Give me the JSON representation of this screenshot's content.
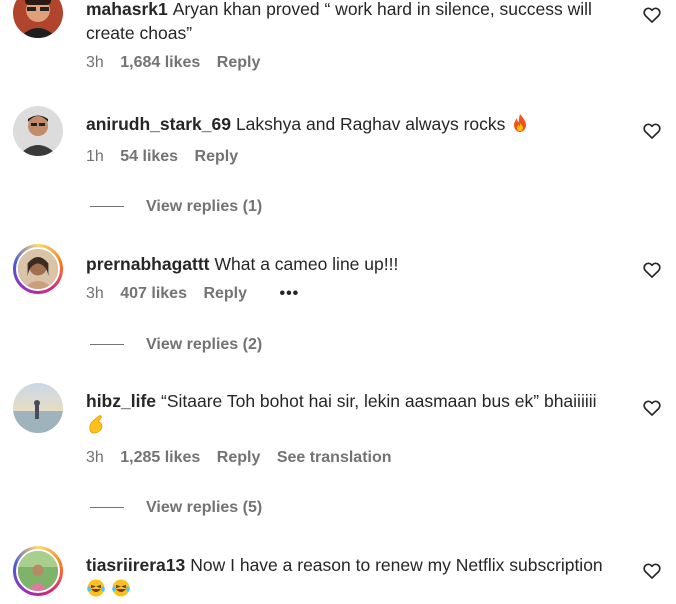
{
  "comments": [
    {
      "username": "mahasrk1",
      "text": "Aryan khan proved “ work hard in silence, success will create choas”",
      "time": "3h",
      "likes": "1,684 likes",
      "reply": "Reply"
    },
    {
      "username": "anirudh_stark_69",
      "text": "Lakshya and Raghav always rocks",
      "time": "1h",
      "likes": "54 likes",
      "reply": "Reply",
      "view_replies": "View replies (1)"
    },
    {
      "username": "prernabhagattt",
      "text": "What a cameo line up!!!",
      "time": "3h",
      "likes": "407 likes",
      "reply": "Reply",
      "more": "•••",
      "view_replies": "View replies (2)"
    },
    {
      "username": "hibz_life",
      "text": "“Sitaare Toh bohot hai sir, lekin aasmaan bus ek” bhaiiiiii",
      "time": "3h",
      "likes": "1,285 likes",
      "reply": "Reply",
      "translation": "See translation",
      "view_replies": "View replies (5)"
    },
    {
      "username": "tiasriirera13",
      "text": "Now I have a reason to renew my Netflix subscription"
    }
  ],
  "icons": {
    "heart": "heart-outline-icon",
    "fire": "fire-emoji-icon",
    "pinch": "pinching-hand-emoji-icon",
    "laugh": "laughing-tears-emoji-icon"
  },
  "colors": {
    "text": "#262626",
    "secondary": "#737373",
    "background": "#ffffff"
  }
}
